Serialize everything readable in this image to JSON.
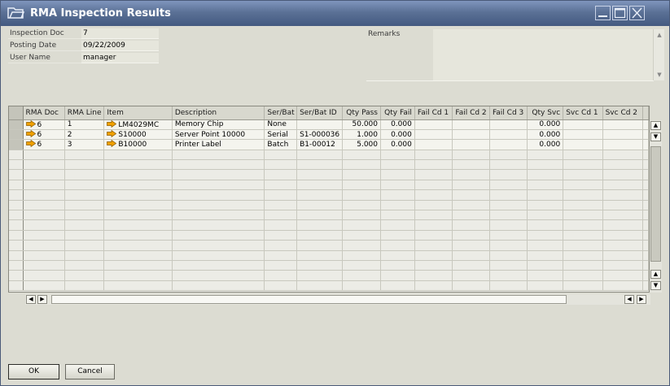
{
  "window": {
    "title": "RMA Inspection Results"
  },
  "header": {
    "fields": [
      {
        "label": "Inspection Doc",
        "value": "7"
      },
      {
        "label": "Posting Date",
        "value": "09/22/2009"
      },
      {
        "label": "User Name",
        "value": "manager"
      }
    ],
    "remarks_label": "Remarks",
    "remarks_value": ""
  },
  "grid": {
    "columns": [
      "RMA Doc",
      "RMA Line",
      "Item",
      "Description",
      "Ser/Bat",
      "Ser/Bat ID",
      "Qty Pass",
      "Qty Fail",
      "Fail Cd 1",
      "Fail Cd 2",
      "Fail Cd 3",
      "Qty Svc",
      "Svc Cd 1",
      "Svc Cd 2"
    ],
    "rows": [
      {
        "rma_doc": "6",
        "rma_line": "1",
        "item": "LM4029MC",
        "description": "Memory Chip",
        "ser_bat": "None",
        "ser_bat_id": "",
        "qty_pass": "50.000",
        "qty_fail": "0.000",
        "fail_cd_1": "",
        "fail_cd_2": "",
        "fail_cd_3": "",
        "qty_svc": "0.000",
        "svc_cd_1": "",
        "svc_cd_2": ""
      },
      {
        "rma_doc": "6",
        "rma_line": "2",
        "item": "S10000",
        "description": "Server Point 10000",
        "ser_bat": "Serial",
        "ser_bat_id": "S1-000036",
        "qty_pass": "1.000",
        "qty_fail": "0.000",
        "fail_cd_1": "",
        "fail_cd_2": "",
        "fail_cd_3": "",
        "qty_svc": "0.000",
        "svc_cd_1": "",
        "svc_cd_2": ""
      },
      {
        "rma_doc": "6",
        "rma_line": "3",
        "item": "B10000",
        "description": "Printer Label",
        "ser_bat": "Batch",
        "ser_bat_id": "B1-00012",
        "qty_pass": "5.000",
        "qty_fail": "0.000",
        "fail_cd_1": "",
        "fail_cd_2": "",
        "fail_cd_3": "",
        "qty_svc": "0.000",
        "svc_cd_1": "",
        "svc_cd_2": ""
      }
    ],
    "empty_rows": 14
  },
  "buttons": {
    "ok": "OK",
    "cancel": "Cancel"
  },
  "icons": {
    "link_arrow": "link-arrow-icon",
    "window": "window-icon",
    "minimize": "minimize-icon",
    "maximize": "maximize-icon",
    "close": "close-icon"
  },
  "colors": {
    "titlebar": "#5b7196",
    "link_arrow": "#f0a000",
    "background": "#dcdcd2"
  }
}
